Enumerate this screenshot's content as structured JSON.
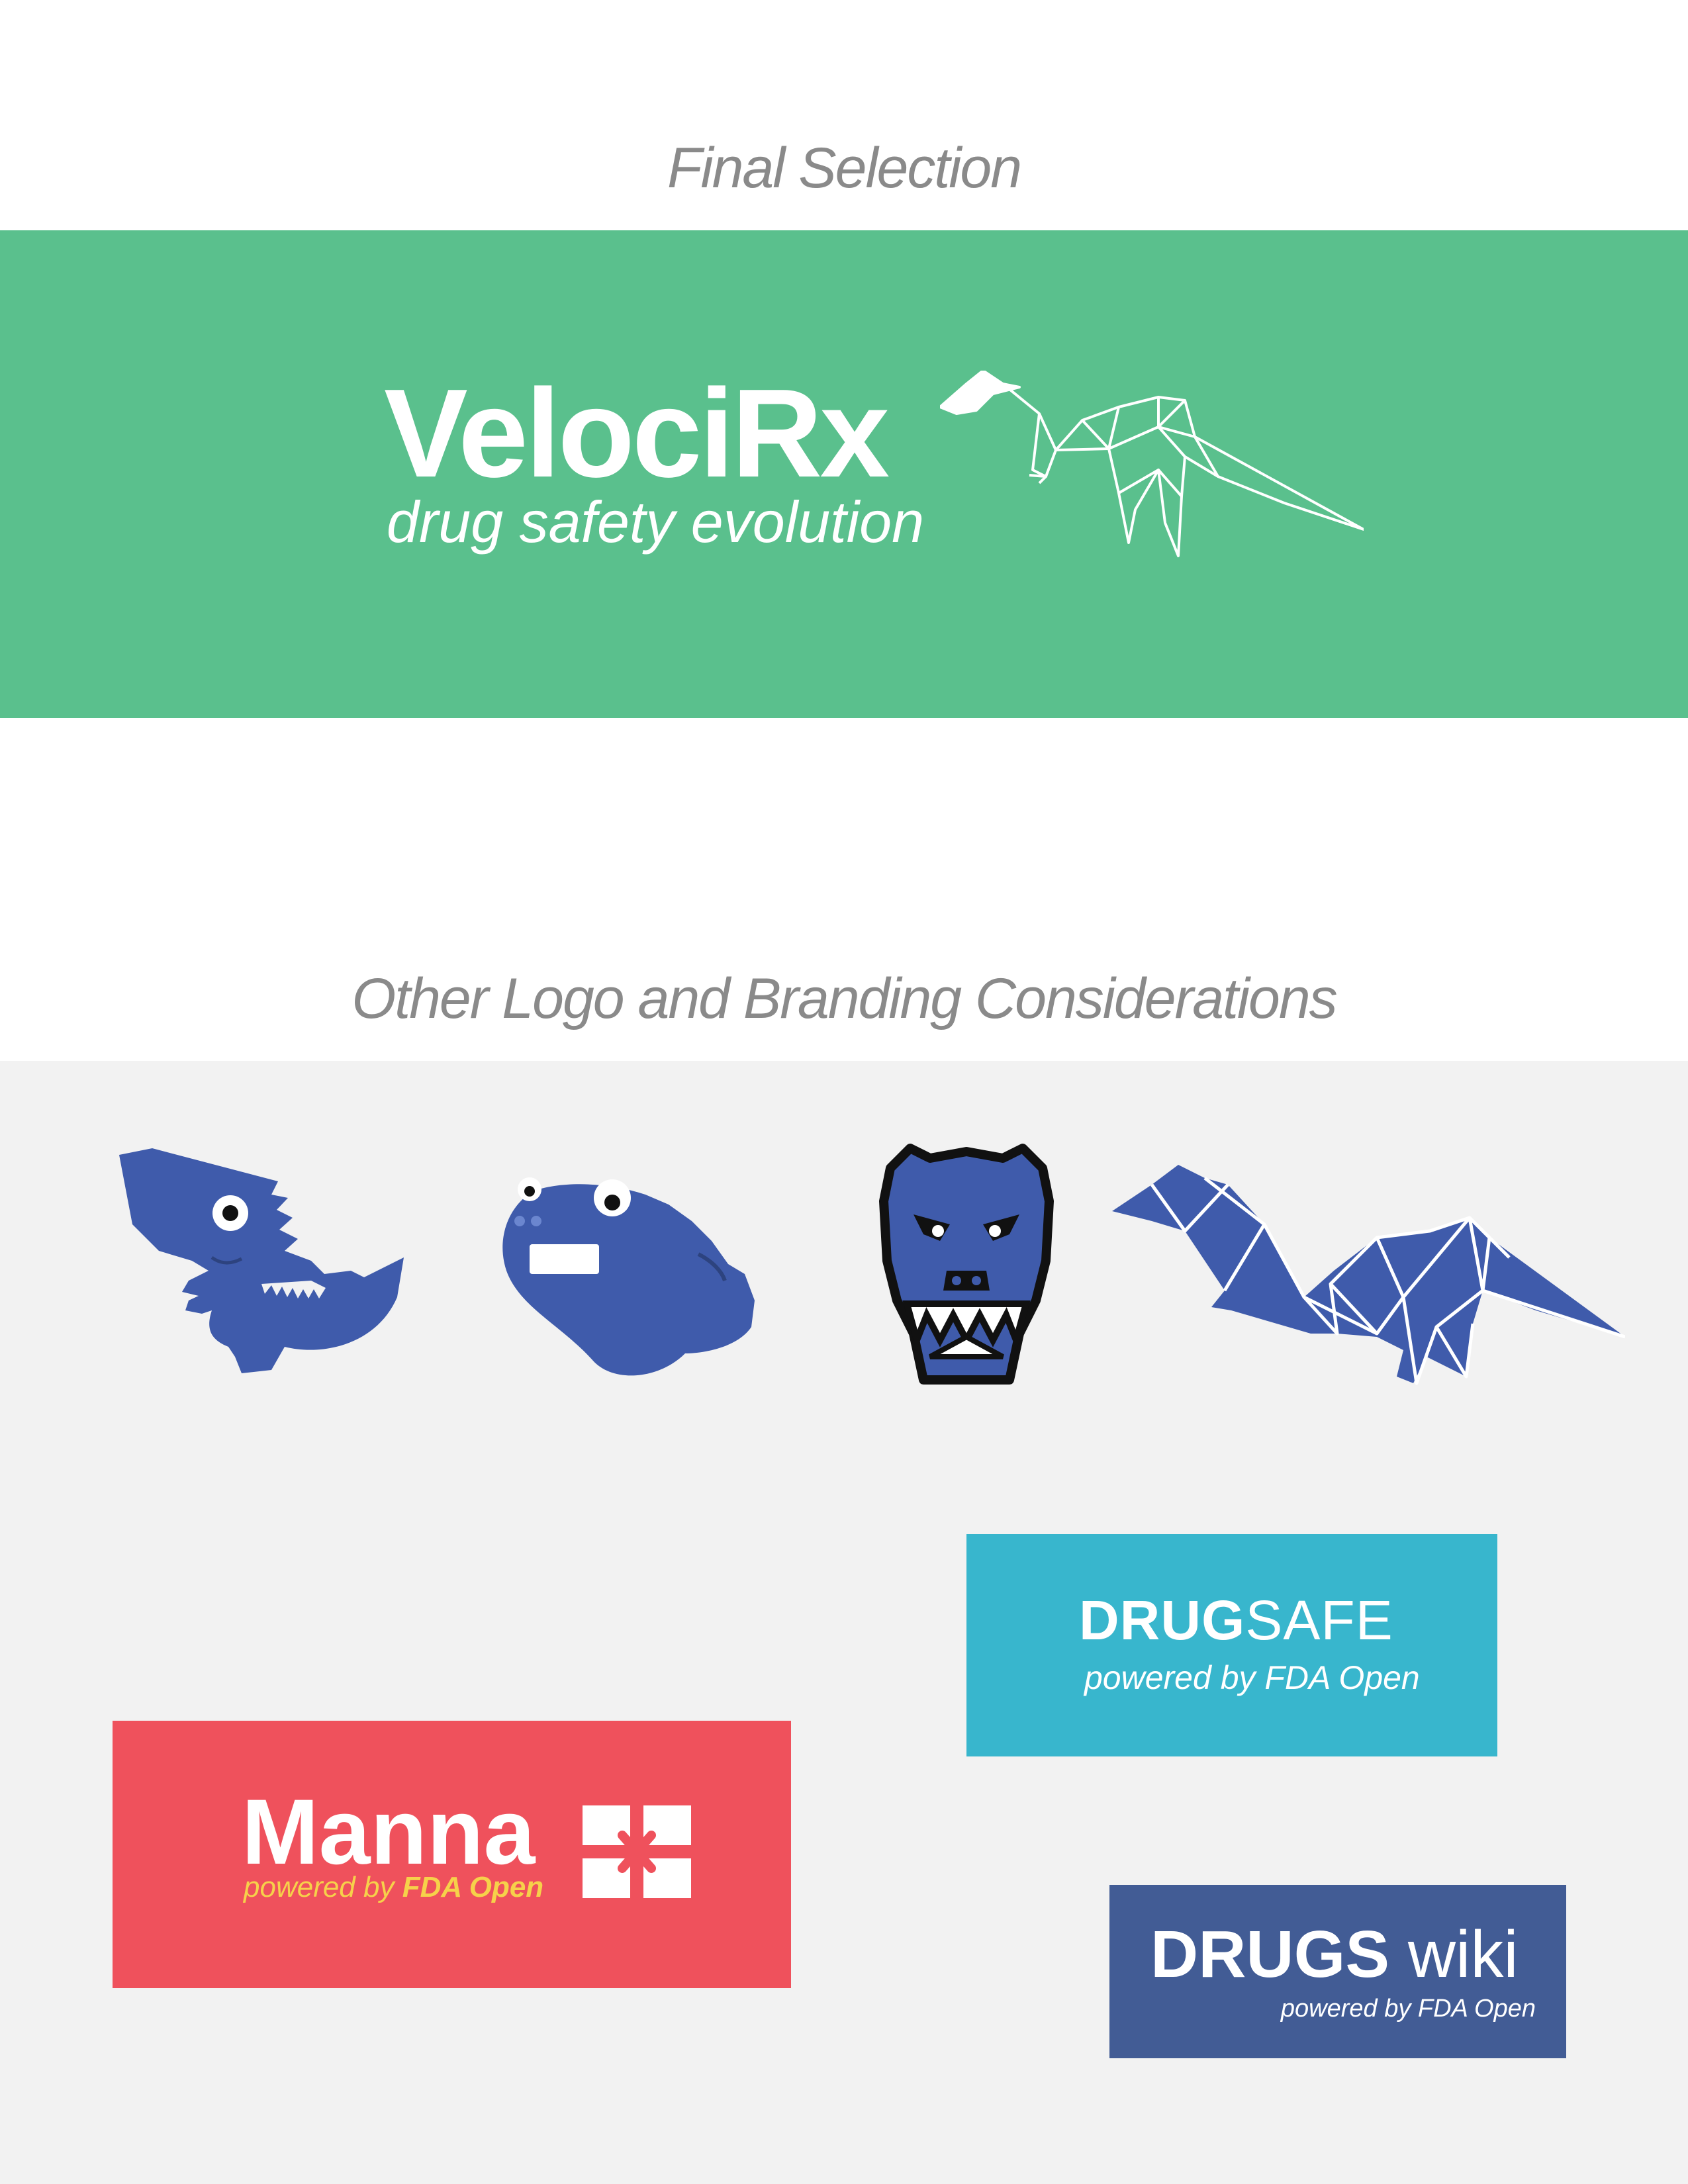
{
  "sections": {
    "final_heading": "Final Selection",
    "other_heading": "Other Logo and Branding Considerations"
  },
  "final_logo": {
    "name": "VelociRx",
    "tagline": "drug safety evolution",
    "band_color": "#5ac08d",
    "icon": "origami-raptor-icon"
  },
  "other_logos": {
    "dinosaur_icons": [
      "cartoon-trex-icon",
      "blob-dino-icon",
      "trex-skull-icon",
      "origami-raptor-icon"
    ],
    "icon_color": "#3f5bab",
    "drugsafe": {
      "title_bold": "DRUG",
      "title_light": "SAFE",
      "subtitle": "powered by FDA Open",
      "color": "#38b6cd"
    },
    "manna": {
      "title": "Manna",
      "subtitle_prefix": "powered by ",
      "subtitle_bold": "FDA Open",
      "color": "#ef515c",
      "accent": "#f6d14a"
    },
    "drugswiki": {
      "title_bold": "DRUGS",
      "title_light": " wiki",
      "subtitle": "powered by FDA Open",
      "color": "#425c95"
    }
  }
}
